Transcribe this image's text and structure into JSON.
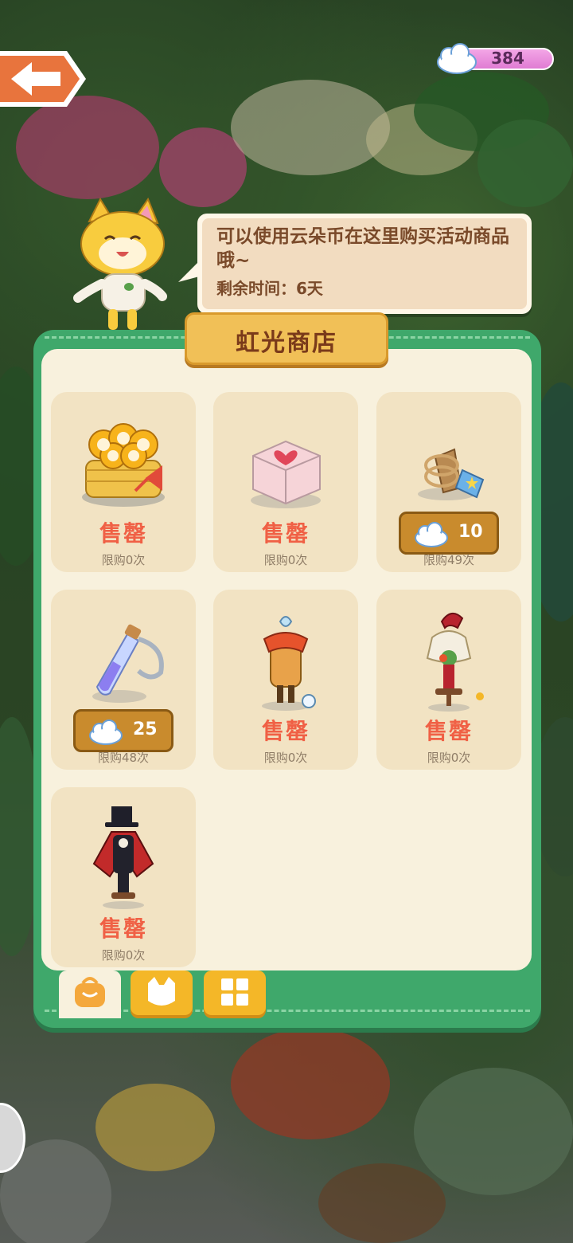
{
  "currency": {
    "amount": "384",
    "icon": "cloud-coin-icon"
  },
  "npc": {
    "message": "可以使用云朵币在这里购买活动商品哦~",
    "time_left": "剩余时间：6天"
  },
  "shop": {
    "title": "虹光商店",
    "items": [
      {
        "name": "sunflower-basket",
        "status": "售罄",
        "limit": "限购0次"
      },
      {
        "name": "heart-cake",
        "status": "售罄",
        "limit": "限购0次"
      },
      {
        "name": "rope-tag",
        "price": "10",
        "limit": "限购49次"
      },
      {
        "name": "potion-bottle",
        "price": "25",
        "limit": "限购48次"
      },
      {
        "name": "orange-outfit",
        "status": "售罄",
        "limit": "限购0次"
      },
      {
        "name": "red-hat-outfit",
        "status": "售罄",
        "limit": "限购0次"
      },
      {
        "name": "magician-outfit",
        "status": "售罄",
        "limit": "限购0次"
      }
    ],
    "tabs": [
      {
        "name": "bag-tab",
        "icon": "bag-icon",
        "active": true
      },
      {
        "name": "cat-tab",
        "icon": "cat-icon",
        "active": false
      },
      {
        "name": "grid-tab",
        "icon": "grid-icon",
        "active": false
      }
    ]
  },
  "colors": {
    "panel_green": "#3fa86b",
    "sold_out_red": "#f06045",
    "badge_gold": "#f1c057"
  }
}
